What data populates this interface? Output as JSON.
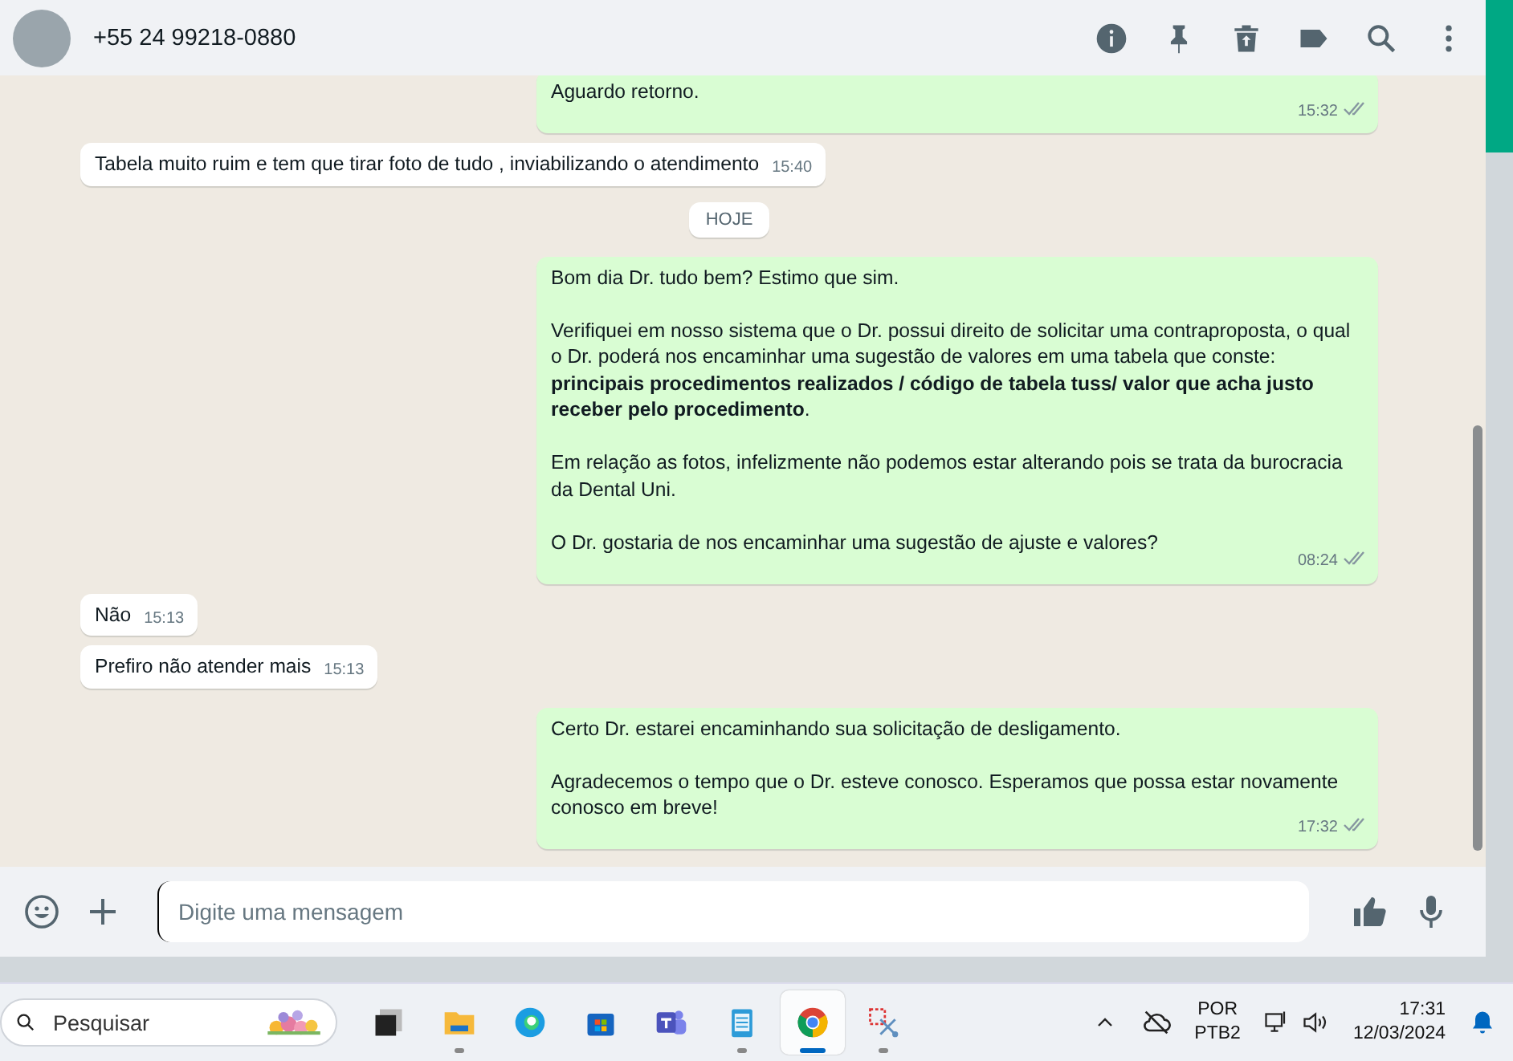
{
  "header": {
    "contact": "+55 24 99218-0880"
  },
  "messages": [
    {
      "kind": "outgoing",
      "paragraphs": [
        "Aguardo retorno."
      ],
      "time": "15:32",
      "read": false
    },
    {
      "kind": "incoming",
      "paragraphs": [
        "Tabela muito ruim e tem que tirar foto de tudo , inviabilizando o atendimento"
      ],
      "time": "15:40"
    },
    {
      "kind": "date",
      "label": "HOJE"
    },
    {
      "kind": "outgoing",
      "paragraphs": [
        "Bom dia Dr. tudo bem? Estimo que sim.",
        "Verifiquei em nosso sistema que o Dr. possui direito de solicitar uma contraproposta, o qual o Dr. poderá nos encaminhar uma sugestão de valores em uma tabela que conste: **principais procedimentos realizados / código de tabela tuss/ valor que acha justo receber pelo procedimento**.",
        "Em relação as fotos, infelizmente não podemos estar alterando pois se trata da burocracia da Dental Uni.",
        "O Dr. gostaria de nos encaminhar uma sugestão de ajuste e valores?"
      ],
      "time": "08:24",
      "read": false
    },
    {
      "kind": "incoming",
      "paragraphs": [
        "Não"
      ],
      "time": "15:13"
    },
    {
      "kind": "incoming",
      "paragraphs": [
        "Prefiro não atender mais"
      ],
      "time": "15:13"
    },
    {
      "kind": "outgoing",
      "paragraphs": [
        "Certo Dr. estarei encaminhando sua solicitação de desligamento.",
        "Agradecemos o tempo que o Dr. esteve conosco. Esperamos que possa estar novamente conosco em breve!"
      ],
      "time": "17:32",
      "read": false
    }
  ],
  "composer": {
    "placeholder": "Digite uma mensagem"
  },
  "taskbar": {
    "search": {
      "placeholder": "Pesquisar"
    },
    "apps": [
      {
        "kind": "taskview",
        "running": false,
        "selected": false
      },
      {
        "kind": "explorer",
        "running": true,
        "selected": false
      },
      {
        "kind": "edge",
        "running": false,
        "selected": false
      },
      {
        "kind": "store",
        "running": false,
        "selected": false
      },
      {
        "kind": "teams",
        "running": false,
        "selected": false
      },
      {
        "kind": "notepad",
        "running": true,
        "selected": false
      },
      {
        "kind": "chrome",
        "running": true,
        "selected": true
      },
      {
        "kind": "snip",
        "running": true,
        "selected": false
      }
    ],
    "language": "POR",
    "layout": "PTB2",
    "time": "17:31",
    "date": "12/03/2024"
  }
}
